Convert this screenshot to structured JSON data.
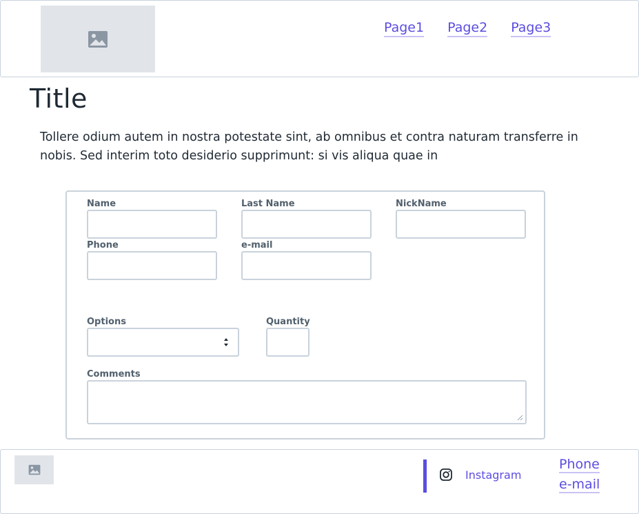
{
  "header": {
    "logo_icon": "image-placeholder-icon",
    "nav": [
      {
        "label": "Page1"
      },
      {
        "label": "Page2"
      },
      {
        "label": "Page3"
      }
    ]
  },
  "main": {
    "title": "Title",
    "lead": "Tollere odium autem in nostra potestate sint, ab omnibus et contra naturam transferre in nobis. Sed interim toto desiderio supprimunt: si vis aliqua quae in"
  },
  "form": {
    "name_label": "Name",
    "name_value": "",
    "last_name_label": "Last Name",
    "last_name_value": "",
    "nickname_label": "NickName",
    "nickname_value": "",
    "phone_label": "Phone",
    "phone_value": "",
    "email_label": "e-mail",
    "email_value": "",
    "options_label": "Options",
    "options_selected": "",
    "quantity_label": "Quantity",
    "quantity_value": "",
    "comments_label": "Comments",
    "comments_value": ""
  },
  "footer": {
    "logo_icon": "image-placeholder-icon",
    "instagram_icon": "instagram-icon",
    "instagram_label": "Instagram",
    "phone_link": "Phone",
    "email_link": "e-mail",
    "accent_color": "#5b4de0"
  }
}
